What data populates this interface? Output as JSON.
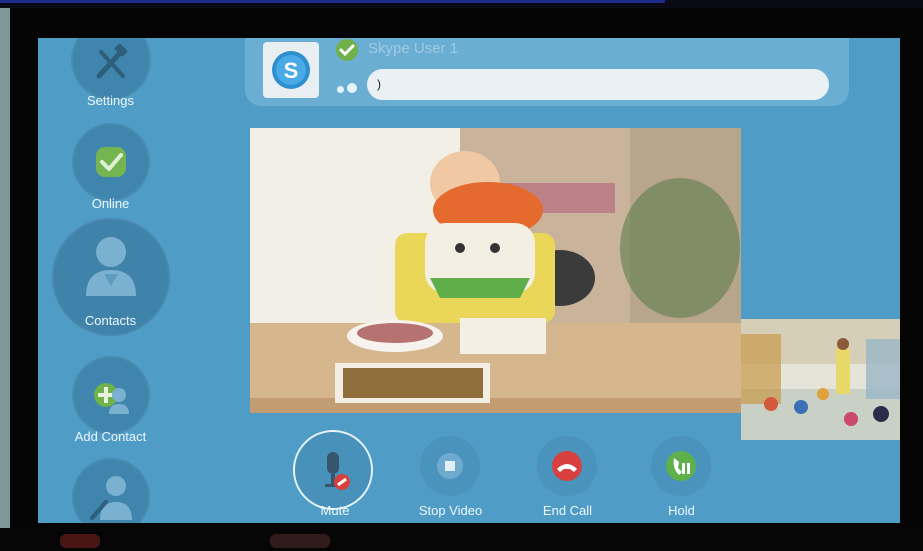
{
  "sidebar": {
    "items": [
      {
        "label": "Settings",
        "icon": "tools-icon"
      },
      {
        "label": "Online",
        "icon": "check-icon"
      },
      {
        "label": "Contacts",
        "icon": "person-icon"
      },
      {
        "label": "Add Contact",
        "icon": "add-person-icon"
      },
      {
        "label": "",
        "icon": "search-icon"
      }
    ]
  },
  "header": {
    "contact_name": "Skype User 1",
    "chat_input_value": ")",
    "avatar_icon": "skype-logo-icon",
    "status_icon": "online-check-icon"
  },
  "video": {
    "main_feed": "remote-video",
    "self_view": "self-video"
  },
  "controls": [
    {
      "label": "Mute",
      "icon": "microphone-muted-icon"
    },
    {
      "label": "Stop Video",
      "icon": "stop-icon"
    },
    {
      "label": "End Call",
      "icon": "hangup-icon"
    },
    {
      "label": "Hold",
      "icon": "hold-icon"
    }
  ],
  "colors": {
    "background": "#4f9cc7",
    "end_call": "#d8403f",
    "hold": "#5db04a",
    "online": "#71b14a"
  }
}
